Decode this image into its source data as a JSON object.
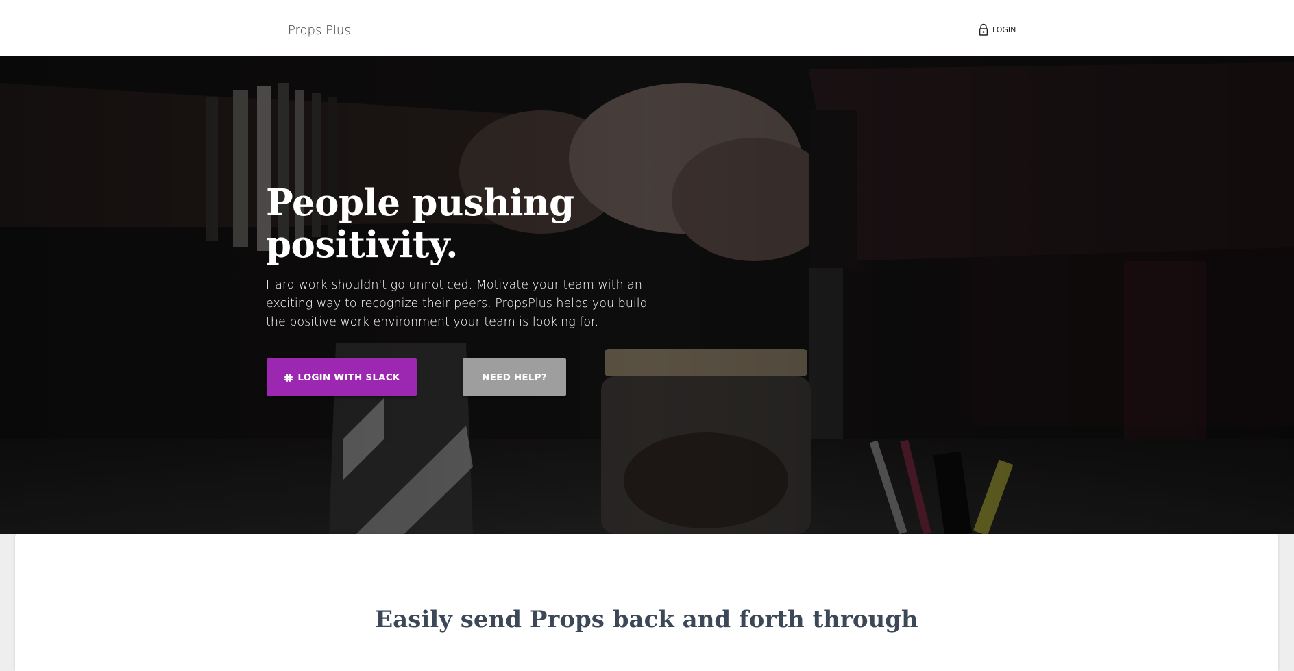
{
  "nav": {
    "brand": "Props Plus",
    "login_label": "LOGIN",
    "login_icon": "lock-icon"
  },
  "hero": {
    "headline": "People pushing positivity.",
    "subtext": "Hard work shouldn't go unnoticed. Motivate your team with an exciting way to recognize their peers. PropsPlus helps you build the positive work environment your team is looking for.",
    "slack_button_label": "LOGIN WITH SLACK",
    "slack_icon": "slack-icon",
    "help_button_label": "NEED HELP?"
  },
  "card": {
    "title": "Easily send Props back and forth through"
  },
  "colors": {
    "accent": "#9c27b0",
    "help_button": "#9e9e9e",
    "title_text": "#3c4858"
  }
}
